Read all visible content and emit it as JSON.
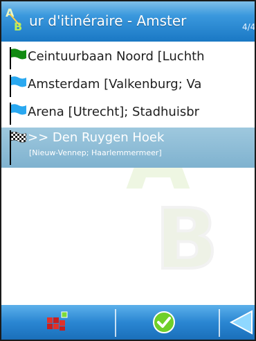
{
  "titlebar": {
    "title": "ur d'itinéraire - Amster",
    "page_indicator": "4/4",
    "logo_letters": [
      "A",
      "B"
    ]
  },
  "watermark": {
    "letters": [
      "A",
      "B"
    ]
  },
  "route": {
    "items": [
      {
        "label": "Ceintuurbaan Noord [Luchth",
        "flag": "green-flag-icon",
        "flag_color": "#128a12"
      },
      {
        "label": "Amsterdam [Valkenburg; Va",
        "flag": "blue-flag-icon",
        "flag_color": "#2aa8f0"
      },
      {
        "label": "Arena [Utrecht]; Stadhuisbr",
        "flag": "blue-flag-icon",
        "flag_color": "#2aa8f0"
      }
    ],
    "destination": {
      "label": ">> Den Ruygen Hoek",
      "sublabel": "[Nieuw-Vennep; Haarlemmermeer]",
      "flag": "checkered-flag-icon"
    }
  },
  "toolbar": {
    "buttons": [
      "map-options-icon",
      "confirm-check-icon",
      "back-arrow-icon"
    ]
  },
  "colors": {
    "bar_blue": "#2a86d2",
    "selected_row": "#8fbcd6",
    "green_flag": "#128a12",
    "blue_flag": "#2aa8f0"
  }
}
